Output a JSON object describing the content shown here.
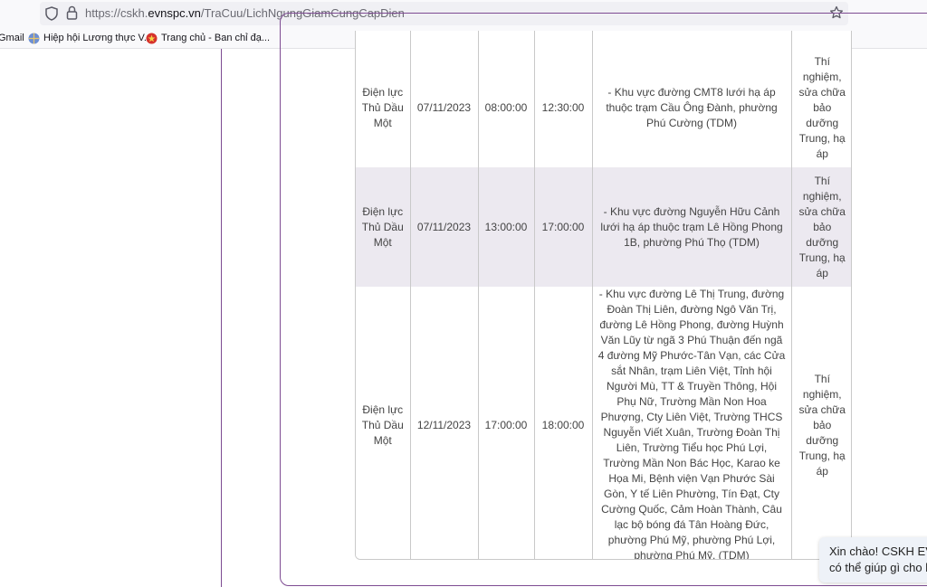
{
  "browser": {
    "url_prefix": "https://cskh.",
    "url_host": "evnspc.vn",
    "url_path": "/TraCuu/LichNgungGiamCungCapDien",
    "bookmarks": [
      "Gmail",
      "Hiệp hội Lương thực V...",
      "Trang chủ - Ban chỉ đạ..."
    ]
  },
  "table": {
    "rows": [
      {
        "unit": "Điện lực Thủ Dầu Một",
        "date": "07/11/2023",
        "start": "08:00:00",
        "end": "12:30:00",
        "area": "- Khu vực đường CMT8 lưới hạ áp thuộc trạm Cầu Ông Đành, phường Phú Cường (TDM)",
        "reason": "Thí nghiệm, sửa chữa bảo dưỡng Trung, hạ áp"
      },
      {
        "unit": "Điện lực Thủ Dầu Một",
        "date": "07/11/2023",
        "start": "13:00:00",
        "end": "17:00:00",
        "area": "- Khu vực đường Nguyễn Hữu Cảnh lưới hạ áp thuộc trạm Lê Hồng Phong 1B, phường Phú Thọ (TDM)",
        "reason": "Thí nghiệm, sửa chữa bảo dưỡng Trung, hạ áp"
      },
      {
        "unit": "Điện lực Thủ Dầu Một",
        "date": "12/11/2023",
        "start": "17:00:00",
        "end": "18:00:00",
        "area": "- Khu vực đường Lê Thị Trung, đường Đoàn Thị Liên, đường Ngô Văn Trị, đường Lê Hồng Phong, đường Huỳnh Văn Lũy từ ngã 3 Phú Thuận đến ngã 4 đường Mỹ Phước-Tân Vạn, các Cửa sắt Nhân, trạm Liên Việt, Tỉnh hội Người Mù, TT & Truyền Thông, Hội Phụ Nữ, Trường Mần Non Hoa Phượng, Cty Liên Việt, Trường THCS Nguyễn Viết Xuân, Trường Đoàn Thị Liên, Trường Tiểu học Phú Lợi, Trường Mần Non Bác Học, Karao ke Họa Mi, Bệnh viện Vạn Phước Sài Gòn, Y tế Liên Phường, Tín Đạt, Cty Cường Quốc, Cảm Hoàn Thành, Câu lạc bộ bóng đá Tân Hoàng Đức, phường Phú Mỹ, phường Phú Lợi, phường Phú Mỹ. (TDM)",
        "reason": "Thí nghiệm, sửa chữa bảo dưỡng Trung, hạ áp"
      }
    ]
  },
  "chat": {
    "line1": "Xin chào! CSKH EVN",
    "line2": "có thể giúp gì cho b"
  },
  "colors": {
    "accent": "#7d4b92",
    "row_alt": "#ece9f0",
    "chat_bg": "#eef2f8"
  }
}
